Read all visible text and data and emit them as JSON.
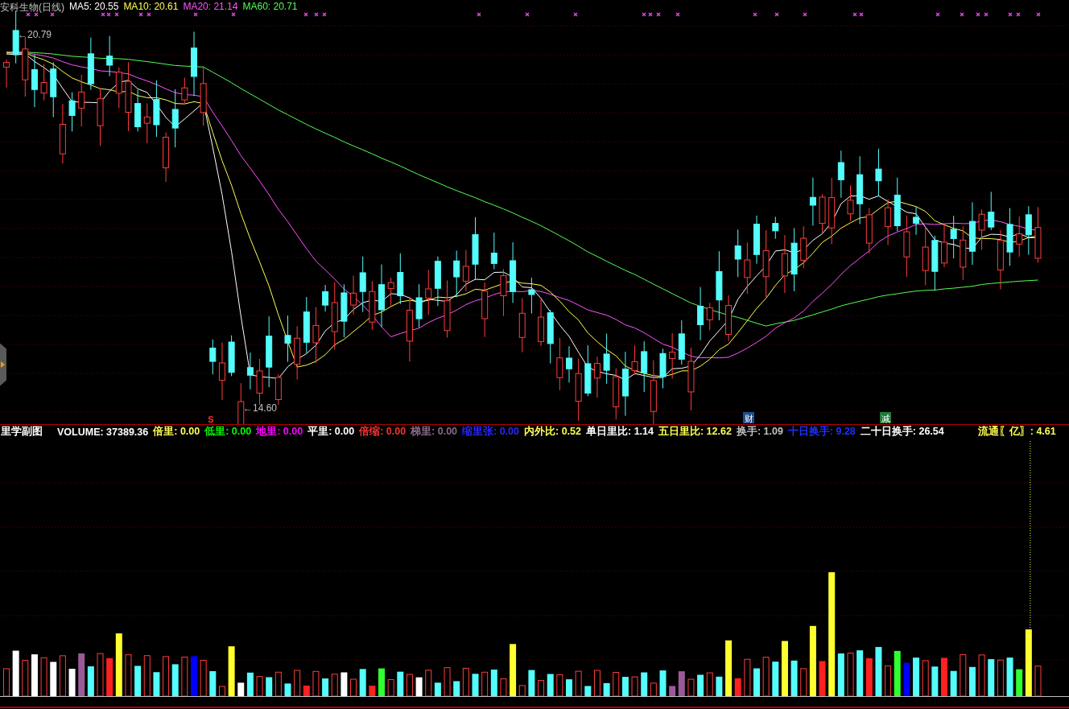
{
  "main_legend": [
    {
      "text": "安科生物(日线)",
      "color": "#c0c0c0"
    },
    {
      "text": "MA5: 20.55",
      "color": "#ffffff"
    },
    {
      "text": "MA10: 20.61",
      "color": "#ffff54"
    },
    {
      "text": "MA20: 21.14",
      "color": "#ff54ff"
    },
    {
      "text": "MA60: 20.71",
      "color": "#54ff54"
    }
  ],
  "price_labels": [
    {
      "text": "←20.79"
    },
    {
      "text": "←14.60"
    }
  ],
  "event_markers": [
    {
      "text": "S",
      "color": "#ff3030"
    },
    {
      "text": "财",
      "color": "#1e4f8f"
    },
    {
      "text": "减",
      "color": "#1f7a3a"
    }
  ],
  "sub_legend": [
    {
      "text": "里学副图",
      "color": "#ffffff"
    },
    {
      "text": "VOLUME: 37389.36",
      "color": "#ffffff"
    },
    {
      "text": "倍里: 0.00",
      "color": "#ffff54"
    },
    {
      "text": "低里: 0.00",
      "color": "#00ff00"
    },
    {
      "text": "地里: 0.00",
      "color": "#ff00ff"
    },
    {
      "text": "平里: 0.00",
      "color": "#ffffff"
    },
    {
      "text": "倍缩: 0.00",
      "color": "#ff3030"
    },
    {
      "text": "梯里: 0.00",
      "color": "#8a6a8a"
    },
    {
      "text": "缩里张: 0.00",
      "color": "#2828ff"
    },
    {
      "text": "内外比: 0.52",
      "color": "#ffff54"
    },
    {
      "text": "单日里比: 1.14",
      "color": "#ffffff"
    },
    {
      "text": "五日里比: 12.62",
      "color": "#ffff54"
    },
    {
      "text": "换手: 1.09",
      "color": "#c0c0c0"
    },
    {
      "text": "十日换手: 9.28",
      "color": "#1e32ff"
    },
    {
      "text": "二十日换手: 26.54",
      "color": "#ffffff"
    },
    {
      "text": "流通〖亿〗: 4.61",
      "color": "#ffff54"
    }
  ]
}
